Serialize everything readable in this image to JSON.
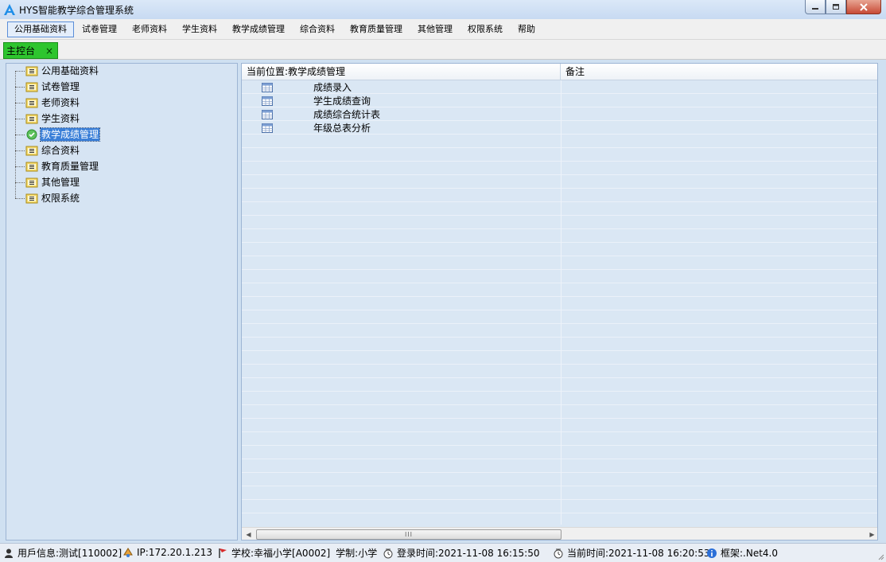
{
  "window": {
    "title": "HYS智能教学综合管理系统"
  },
  "menubar": {
    "items": [
      {
        "label": "公用基础资料",
        "active": true
      },
      {
        "label": "试卷管理"
      },
      {
        "label": "老师资料"
      },
      {
        "label": "学生资料"
      },
      {
        "label": "教学成绩管理"
      },
      {
        "label": "综合资料"
      },
      {
        "label": "教育质量管理"
      },
      {
        "label": "其他管理"
      },
      {
        "label": "权限系统"
      },
      {
        "label": "帮助"
      }
    ]
  },
  "tabs": {
    "active_tab": "主控台",
    "close_glyph": "×"
  },
  "tree": {
    "items": [
      {
        "label": "公用基础资料",
        "icon": "folder-icon"
      },
      {
        "label": "试卷管理",
        "icon": "folder-icon"
      },
      {
        "label": "老师资料",
        "icon": "folder-icon"
      },
      {
        "label": "学生资料",
        "icon": "folder-icon"
      },
      {
        "label": "教学成绩管理",
        "icon": "check-circle-icon",
        "selected": true
      },
      {
        "label": "综合资料",
        "icon": "folder-icon"
      },
      {
        "label": "教育质量管理",
        "icon": "folder-icon"
      },
      {
        "label": "其他管理",
        "icon": "folder-icon"
      },
      {
        "label": "权限系统",
        "icon": "folder-icon"
      }
    ]
  },
  "grid": {
    "header_location": "当前位置:教学成绩管理",
    "header_remark": "备注",
    "rows": [
      {
        "label": "成绩录入",
        "icon": "table-icon"
      },
      {
        "label": "学生成绩查询",
        "icon": "table-icon"
      },
      {
        "label": "成绩综合统计表",
        "icon": "table-icon"
      },
      {
        "label": "年级总表分析",
        "icon": "table-icon"
      }
    ],
    "scroll_thumb_glyph": "III"
  },
  "statusbar": {
    "user": "用戶信息:测试[110002]",
    "ip": "IP:172.20.1.213",
    "school": "学校:幸福小学[A0002]",
    "school_system": "学制:小学",
    "login_time": "登录时间:2021-11-08 16:15:50",
    "current_time": "当前时间:2021-11-08 16:20:53",
    "framework": "框架:.Net4.0"
  },
  "colors": {
    "tab_active": "#2ec52e",
    "tree_selected": "#3a7fd8",
    "panel_bg": "#d6e4f3",
    "close_button": "#c74a36"
  }
}
